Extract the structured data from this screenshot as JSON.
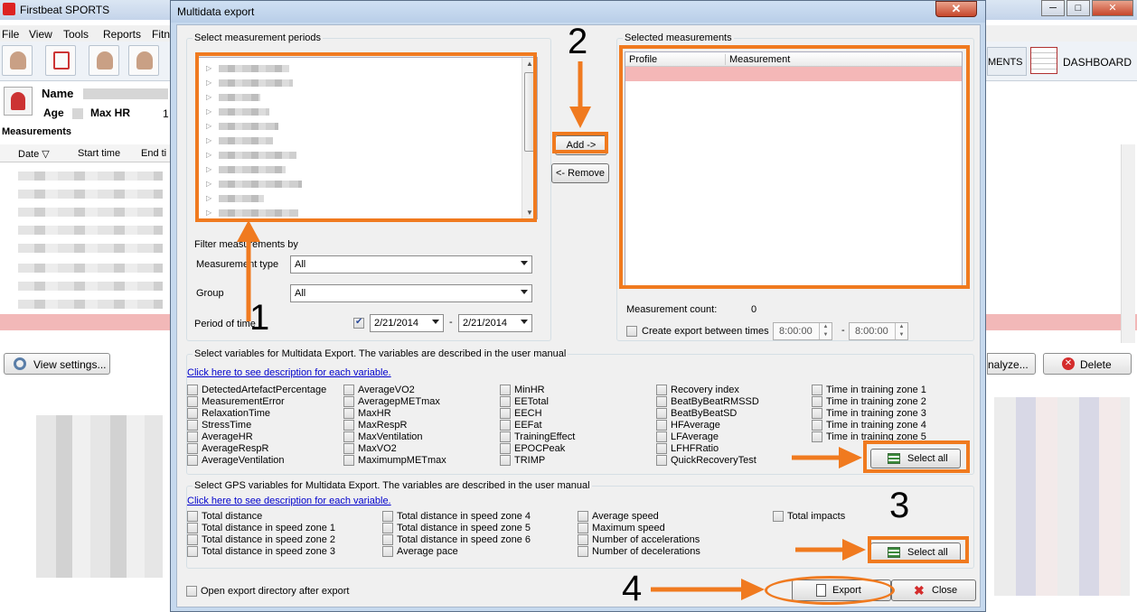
{
  "app": {
    "title": "Firstbeat SPORTS",
    "menu": [
      "File",
      "View",
      "Tools",
      "Reports",
      "Fitn"
    ],
    "tabs": {
      "measurements_partial": "MENTS",
      "dashboard": "DASHBOARD"
    },
    "profile": {
      "name_label": "Name",
      "age_label": "Age",
      "maxhr_label": "Max HR",
      "maxhr_value_partial": "1"
    },
    "measurements_title": "Measurements",
    "columns": [
      "Date ▽",
      "Start time",
      "End ti"
    ],
    "buttons": {
      "view_settings": "View settings...",
      "analyze_partial": "nalyze...",
      "delete": "Delete"
    },
    "window_controls": [
      "─",
      "□",
      "✕"
    ]
  },
  "dialog": {
    "title": "Multidata export",
    "close_label": "✕",
    "periods_title": "Select measurement periods",
    "filter_title": "Filter measurements by",
    "filter": {
      "type_label": "Measurement type",
      "type_value": "All",
      "group_label": "Group",
      "group_value": "All",
      "period_label": "Period of time",
      "date_from": "2/21/2014",
      "date_to": "2/21/2014",
      "date_sep": "-"
    },
    "add_button": "Add ->",
    "remove_button": "<- Remove",
    "selected_title": "Selected measurements",
    "selected_cols": [
      "Profile",
      "Measurement"
    ],
    "measurement_count_label": "Measurement count:",
    "measurement_count_value": "0",
    "export_between_label": "Create export between times",
    "time_from": "8:00:00",
    "time_to": "8:00:00",
    "time_sep": "-",
    "vars_title": "Select variables for Multidata Export. The variables are described in the user manual",
    "vars_link": "Click here to see description for each variable.",
    "vars_columns": [
      [
        "DetectedArtefactPercentage",
        "MeasurementError",
        "RelaxationTime",
        "StressTime",
        "AverageHR",
        "AverageRespR",
        "AverageVentilation"
      ],
      [
        "AverageVO2",
        "AveragepMETmax",
        "MaxHR",
        "MaxRespR",
        "MaxVentilation",
        "MaxVO2",
        "MaximumpMETmax"
      ],
      [
        "MinHR",
        "EETotal",
        "EECH",
        "EEFat",
        "TrainingEffect",
        "EPOCPeak",
        "TRIMP"
      ],
      [
        "Recovery index",
        "BeatByBeatRMSSD",
        "BeatByBeatSD",
        "HFAverage",
        "LFAverage",
        "LFHFRatio",
        "QuickRecoveryTest"
      ],
      [
        "Time in training zone 1",
        "Time in training zone 2",
        "Time in training zone 3",
        "Time in training zone 4",
        "Time in training zone 5"
      ]
    ],
    "select_all_1": "Select all",
    "gps_title": "Select GPS variables for Multidata Export. The variables are described in the user manual",
    "gps_link": "Click here to see description for each variable.",
    "gps_columns": [
      [
        "Total distance",
        "Total distance in speed zone 1",
        "Total distance in speed zone 2",
        "Total distance in speed zone 3"
      ],
      [
        "Total distance in speed zone 4",
        "Total distance in speed zone 5",
        "Total distance in speed zone 6",
        "Average pace"
      ],
      [
        "Average speed",
        "Maximum speed",
        "Number of accelerations",
        "Number of decelerations"
      ],
      [
        "Total impacts"
      ]
    ],
    "select_all_2": "Select all",
    "open_dir_label": "Open export directory after export",
    "export_button": "Export",
    "close_button": "Close"
  },
  "annotations": [
    "1",
    "2",
    "3",
    "4"
  ],
  "colors": {
    "annotation": "#f07a1f",
    "selected_row": "#f4b7b7",
    "dialog_frame": "#c6d9ee"
  }
}
